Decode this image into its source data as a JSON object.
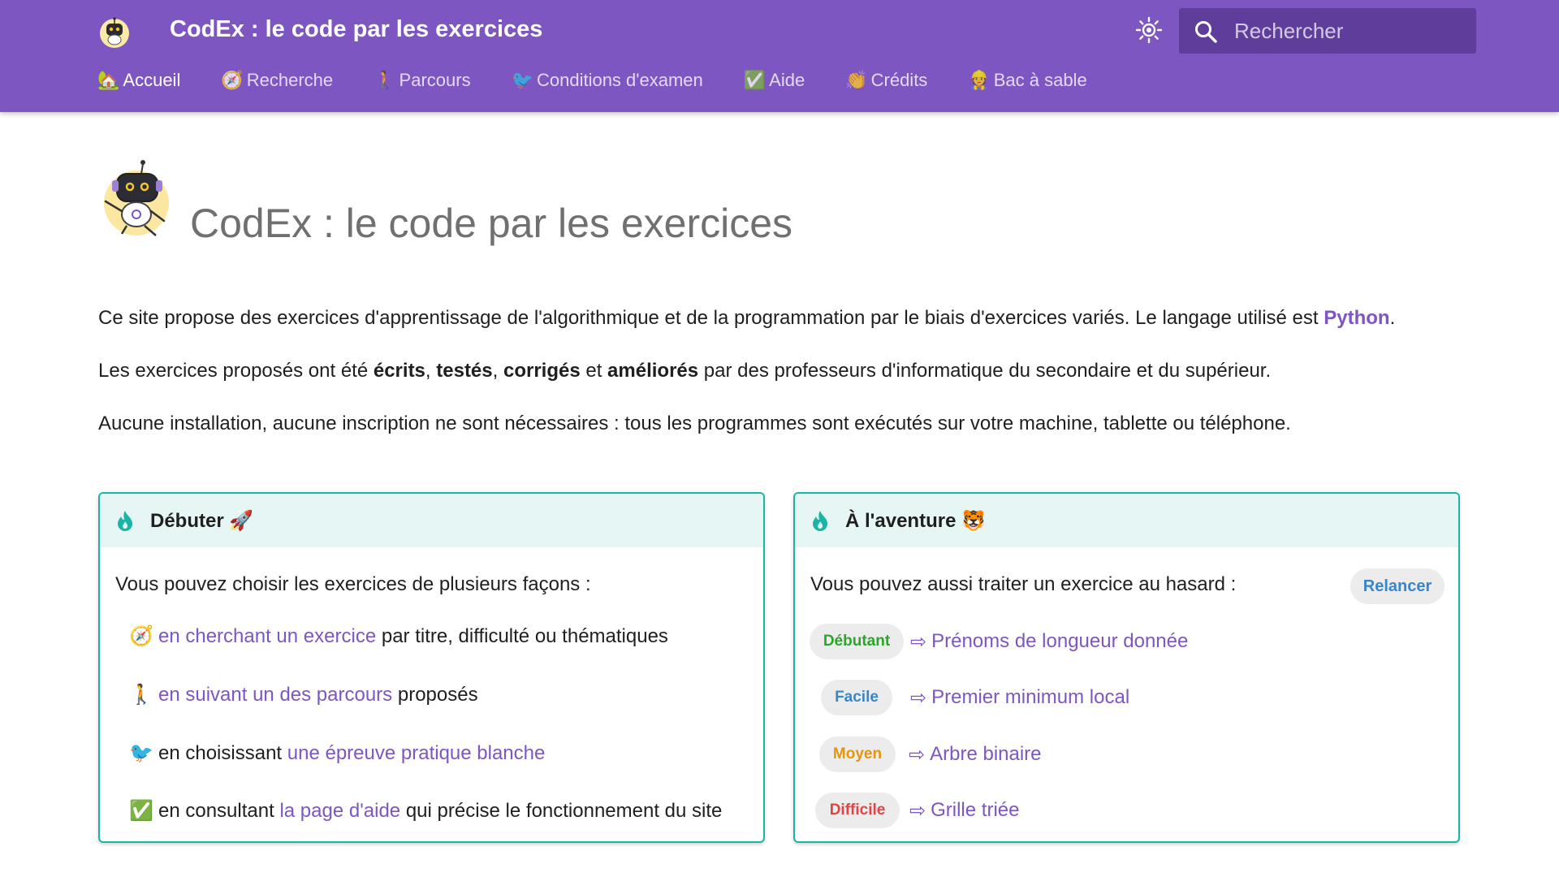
{
  "header": {
    "title": "CodEx : le code par les exercices",
    "search_placeholder": "Rechercher",
    "colors": {
      "primary": "#7e56c2",
      "search_bg": "#5f3e9b"
    }
  },
  "nav": [
    {
      "emoji": "🏡",
      "label": "Accueil",
      "active": true
    },
    {
      "emoji": "🧭",
      "label": "Recherche"
    },
    {
      "emoji": "🚶",
      "label": "Parcours"
    },
    {
      "emoji": "🐦",
      "label": "Conditions d'examen"
    },
    {
      "emoji": "✅",
      "label": "Aide"
    },
    {
      "emoji": "👏",
      "label": "Crédits"
    },
    {
      "emoji": "👷",
      "label": "Bac à sable"
    }
  ],
  "main": {
    "title": "CodEx : le code par les exercices",
    "p1": {
      "before": "Ce site propose des exercices d'apprentissage de l'algorithmique et de la programmation par le biais d'exercices variés. Le langage utilisé est ",
      "link": "Python",
      "after": "."
    },
    "p2": {
      "a": "Les exercices proposés ont été ",
      "w1": "écrits",
      "s1": ", ",
      "w2": "testés",
      "s2": ", ",
      "w3": "corrigés",
      "s3": " et ",
      "w4": "améliorés",
      "end": " par des professeurs d'informatique du secondaire et du supérieur."
    },
    "p3": "Aucune installation, aucune inscription ne sont nécessaires : tous les programmes sont exécutés sur votre machine, tablette ou téléphone."
  },
  "card_left": {
    "title": "Débuter 🚀",
    "intro": "Vous pouvez choisir les exercices de plusieurs façons :",
    "items": [
      {
        "emoji": "🧭",
        "pre": "",
        "link": "en cherchant un exercice",
        "post": " par titre, difficulté ou thématiques"
      },
      {
        "emoji": "🚶",
        "pre": "",
        "link": "en suivant un des parcours",
        "post": " proposés"
      },
      {
        "emoji": "🐦",
        "pre": "en choisissant ",
        "link": "une épreuve pratique blanche",
        "post": ""
      },
      {
        "emoji": "✅",
        "pre": "en consultant ",
        "link": "la page d'aide",
        "post": " qui précise le fonctionnement du site"
      }
    ]
  },
  "card_right": {
    "title": "À l'aventure 🐯",
    "intro": "Vous pouvez aussi traiter un exercice au hasard :",
    "relaunch": "Relancer",
    "exercises": [
      {
        "level": "Débutant",
        "color": "#2aa62a",
        "title": "Prénoms de longueur donnée"
      },
      {
        "level": "Facile",
        "color": "#3a86c8",
        "title": "Premier minimum local"
      },
      {
        "level": "Moyen",
        "color": "#e3960f",
        "title": "Arbre binaire"
      },
      {
        "level": "Difficile",
        "color": "#e04545",
        "title": "Grille triée"
      }
    ]
  },
  "icons": [
    "codex-logo-icon",
    "sun-icon",
    "search-icon",
    "flame-icon",
    "arrow-right-icon"
  ],
  "accent_colors": {
    "card_border": "#1bb5a5",
    "card_header": "#e6f6f4",
    "link": "#7e56c2"
  }
}
